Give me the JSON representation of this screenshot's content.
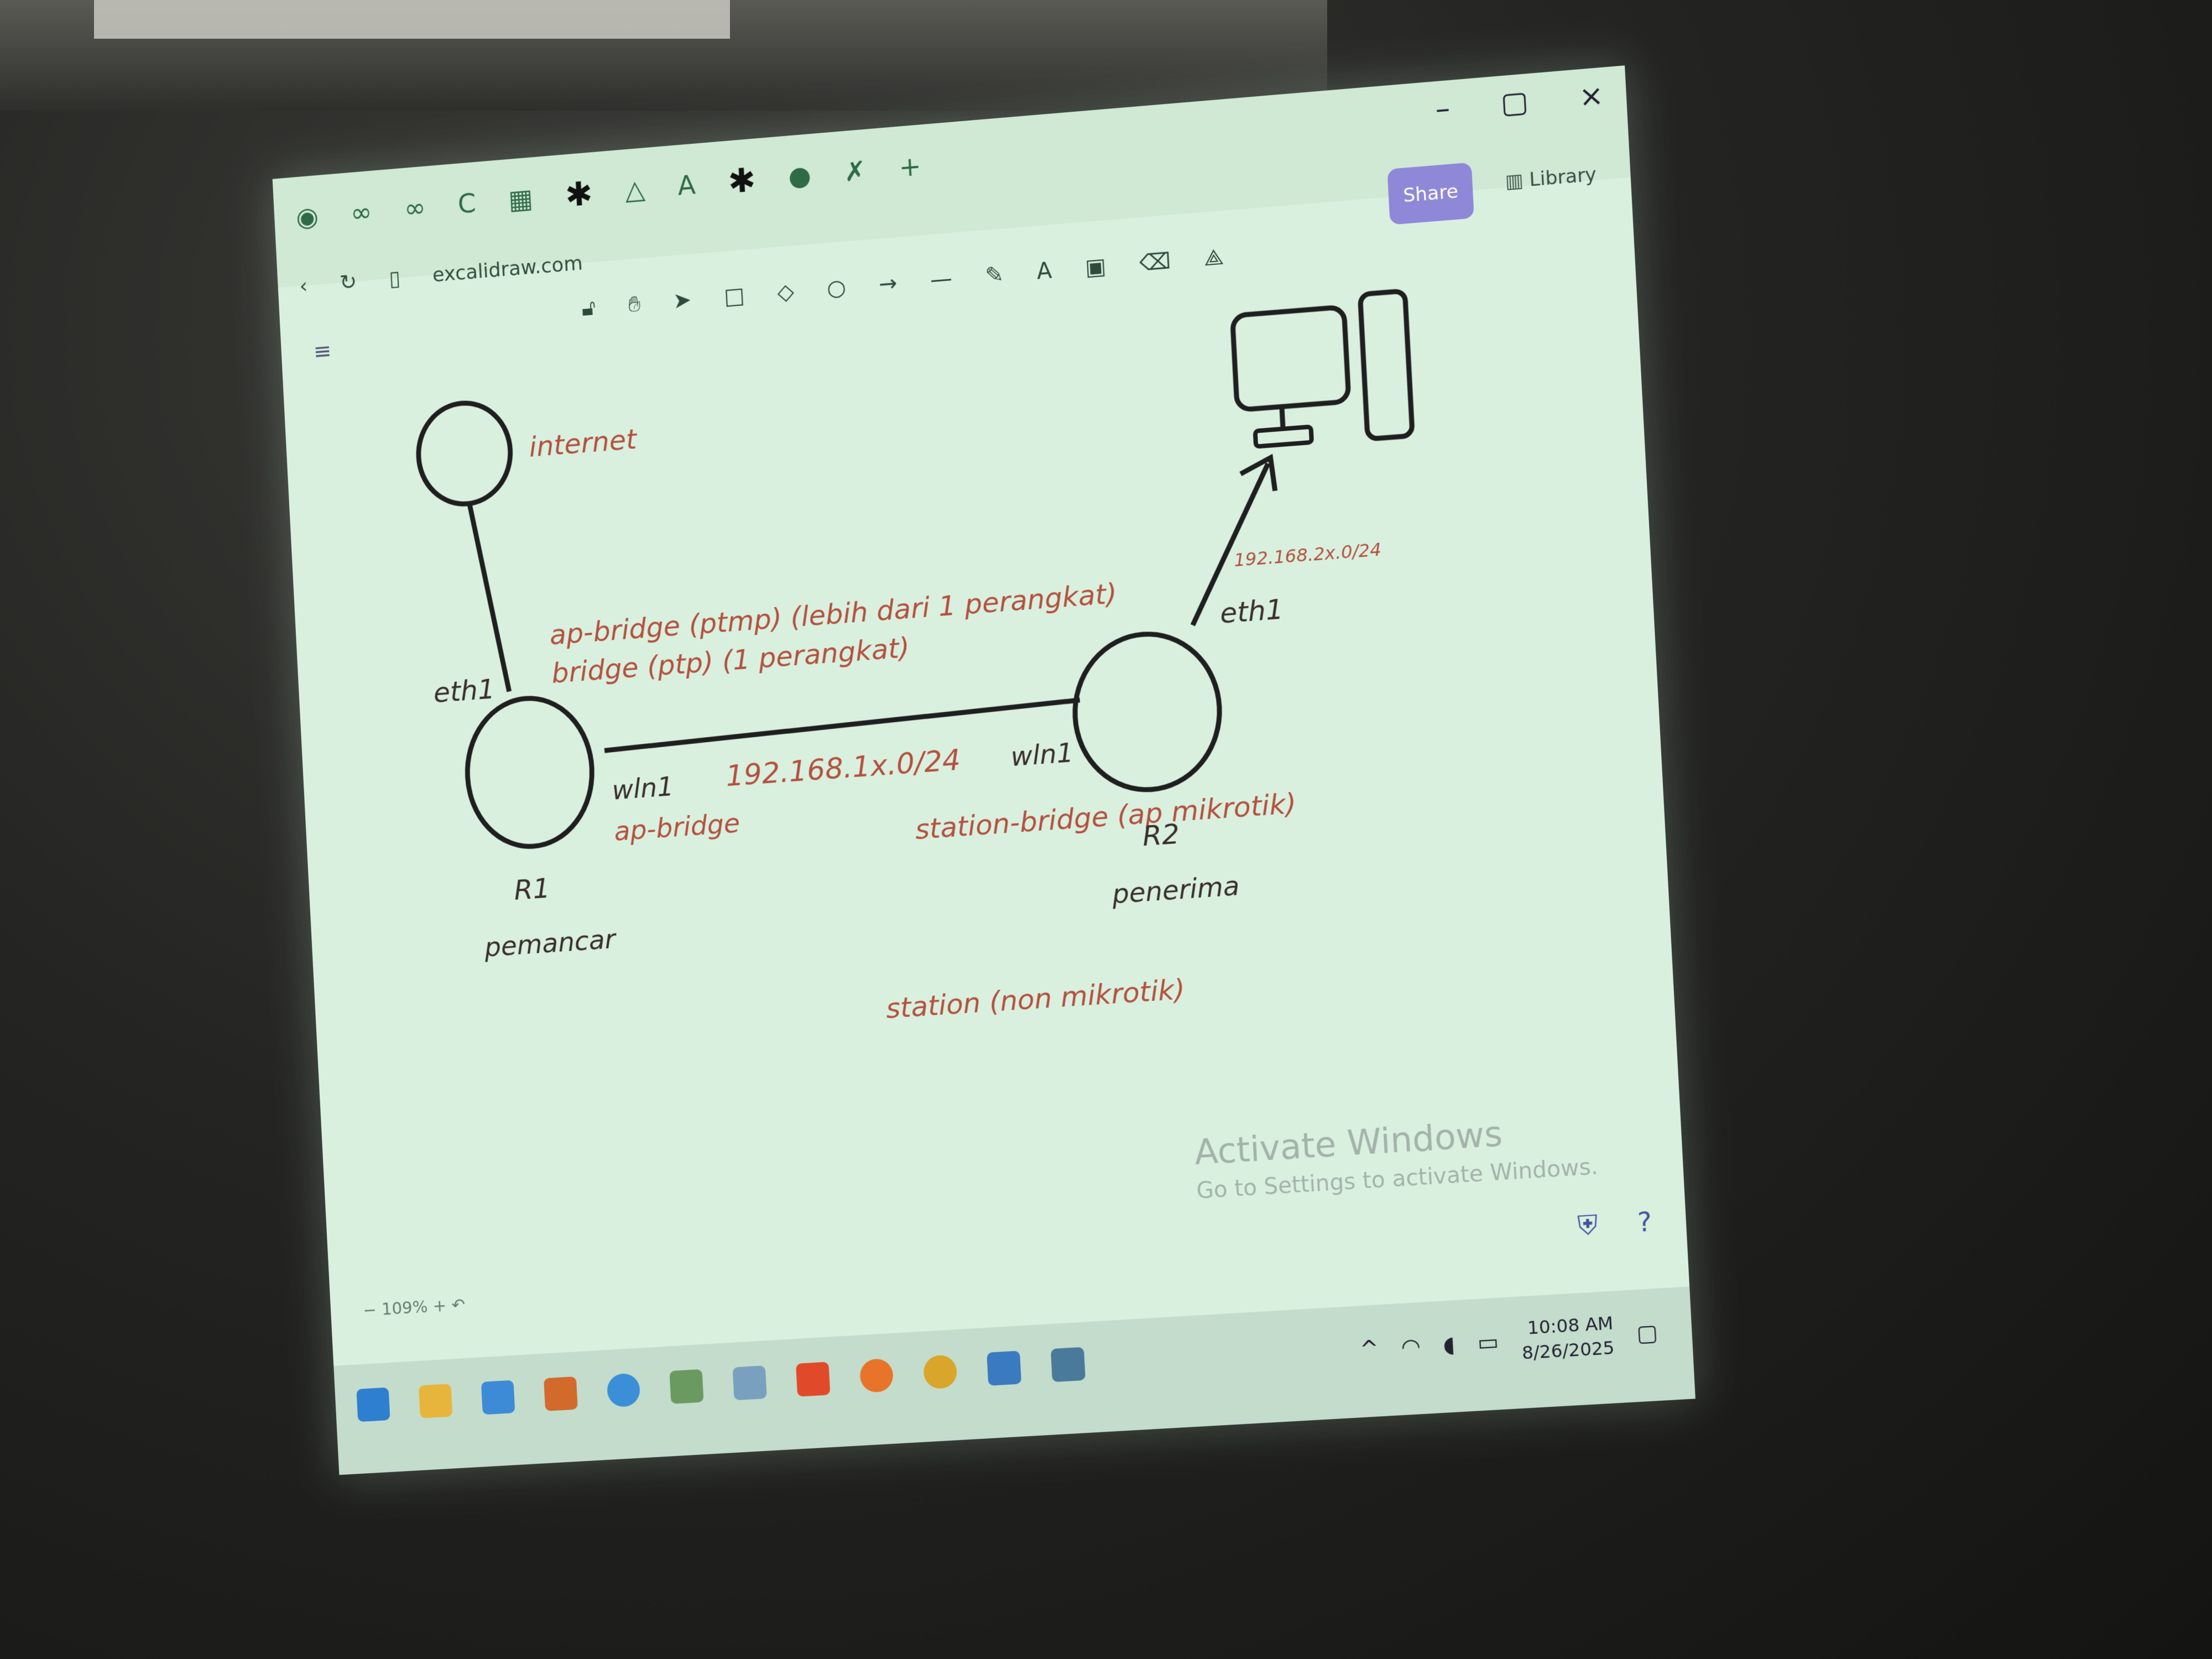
{
  "browser": {
    "url": "excalidraw.com",
    "share_label": "Share",
    "library_label": "Library",
    "window_controls": [
      "–",
      "▢",
      "×"
    ]
  },
  "diagram": {
    "internet": "internet",
    "eth1_left": "eth1",
    "mode_line1": "ap-bridge (ptmp) (lebih dari 1 perangkat)",
    "mode_line2": "bridge (ptp) (1 perangkat)",
    "wln1_left": "wln1",
    "subnet_link": "192.168.1x.0/24",
    "wln1_right": "wln1",
    "ap_bridge": "ap-bridge",
    "station_bridge": "station-bridge (ap mikrotik)",
    "r1": "R1",
    "r2": "R2",
    "pemancar": "pemancar",
    "penerima": "penerima",
    "station": "station (non mikrotik)",
    "eth1_right": "eth1",
    "subnet_pc": "192.168.2x.0/24"
  },
  "overlay": {
    "activate_title": "Activate Windows",
    "activate_sub": "Go to Settings to activate Windows."
  },
  "statusbar": {
    "zoom": "109%"
  },
  "taskbar": {
    "time": "10:08 AM",
    "date": "8/26/2025"
  },
  "colors": {
    "screen": "#d9f0df",
    "ink": "#1f1f1f",
    "red_text": "#b4503e",
    "share": "#8f88d8"
  }
}
